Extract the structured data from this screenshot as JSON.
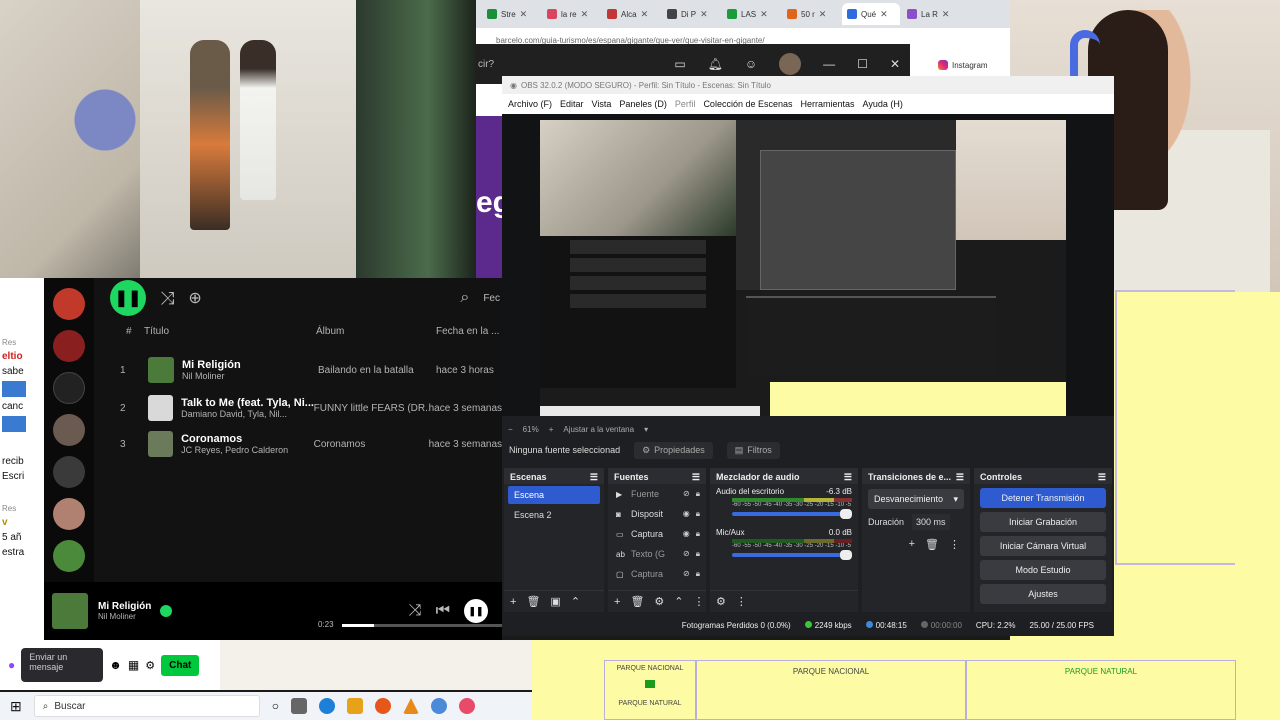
{
  "browser": {
    "tabs": [
      {
        "label": "Stre",
        "color": "#1a8f3a"
      },
      {
        "label": "la re",
        "color": "#d9455f"
      },
      {
        "label": "Alca",
        "color": "#c13737"
      },
      {
        "label": "Di P",
        "color": "#444444"
      },
      {
        "label": "LAS",
        "color": "#1a9c3a"
      },
      {
        "label": "50 r",
        "color": "#e0641a"
      },
      {
        "label": "Qué",
        "color": "#2f6be0"
      },
      {
        "label": "La R",
        "color": "#8a4fc9"
      }
    ],
    "url": "barcelo.com/guia-turismo/es/espana/gigante/que-ver/que-visitar-en-gigante/",
    "popup_query": "cir?",
    "instagram": "Instagram",
    "page_text": "eg"
  },
  "obs": {
    "title": "OBS 32.0.2 (MODO SEGURO) - Perfil: Sin Título - Escenas: Sin Título",
    "menu": [
      "Archivo (F)",
      "Editar",
      "Vista",
      "Paneles (D)",
      "Perfil",
      "Colección de Escenas",
      "Herramientas",
      "Ayuda (H)"
    ],
    "zoom": "61%",
    "fit": "Ajustar a la ventana",
    "no_source": "Ninguna fuente seleccionad",
    "properties": "Propiedades",
    "filters": "Filtros",
    "docks": {
      "scenes_title": "Escenas",
      "scenes": [
        "Escena",
        "Escena 2"
      ],
      "sources_title": "Fuentes",
      "sources": [
        "Fuente",
        "Disposit",
        "Captura",
        "Texto (G",
        "Captura"
      ],
      "mixer_title": "Mezclador de audio",
      "mixer": [
        {
          "name": "Audio del escritorio",
          "db": "-6.3 dB"
        },
        {
          "name": "Mic/Aux",
          "db": "0.0 dB"
        }
      ],
      "scale": "-60 -55 -50 -45 -40 -35 -30 -25 -20 -15 -10 -5 0",
      "transitions_title": "Transiciones de e...",
      "transition": "Desvanecimiento",
      "duration_label": "Duración",
      "duration": "300 ms",
      "controls_title": "Controles",
      "controls": [
        "Detener Transmisión",
        "Iniciar Grabación",
        "Iniciar Cámara Virtual",
        "Modo Estudio",
        "Ajustes"
      ]
    },
    "status": {
      "dropped": "Fotogramas Perdidos 0 (0.0%)",
      "bitrate": "2249 kbps",
      "live": "00:48:15",
      "rec": "00:00:00",
      "cpu": "CPU: 2.2%",
      "fps": "25.00 / 25.00 FPS"
    }
  },
  "spotify": {
    "columns": {
      "num": "#",
      "title": "Título",
      "album": "Álbum",
      "date": "Fecha en la ..."
    },
    "tracks": [
      {
        "num": "1",
        "title": "Mi Religión",
        "artist": "Nil Moliner",
        "album": "Bailando en la batalla",
        "date": "hace 3 horas",
        "cover": "#4c7a3a"
      },
      {
        "num": "2",
        "title": "Talk to Me (feat. Tyla, Ni...",
        "artist": "Damiano David, Tyla, Nil...",
        "album": "FUNNY little FEARS (DR...",
        "date": "hace 3 semanas",
        "cover": "#d9d9d9"
      },
      {
        "num": "3",
        "title": "Coronamos",
        "artist": "JC Reyes, Pedro Calderon",
        "album": "Coronamos",
        "date": "hace 3 semanas",
        "cover": "#6a7a5a"
      }
    ],
    "header_right": "Fec",
    "now_playing": {
      "title": "Mi Religión",
      "artist": "Nil Moliner",
      "time": "0:23"
    }
  },
  "chat": {
    "lines": [
      "Res",
      "eltio",
      "sabe",
      "",
      "canc",
      "",
      "recib",
      "Escri",
      "",
      "Res",
      "v",
      "5 añ",
      "estra"
    ],
    "input_placeholder": "Enviar un mensaje",
    "send_label": "Chat"
  },
  "taskbar": {
    "search": "Buscar"
  },
  "plan": {
    "labels": [
      "PARQUE NACIONAL",
      "PARQUE NACIONAL",
      "PARQUE NATURAL",
      "PARQUE NATURAL"
    ]
  }
}
